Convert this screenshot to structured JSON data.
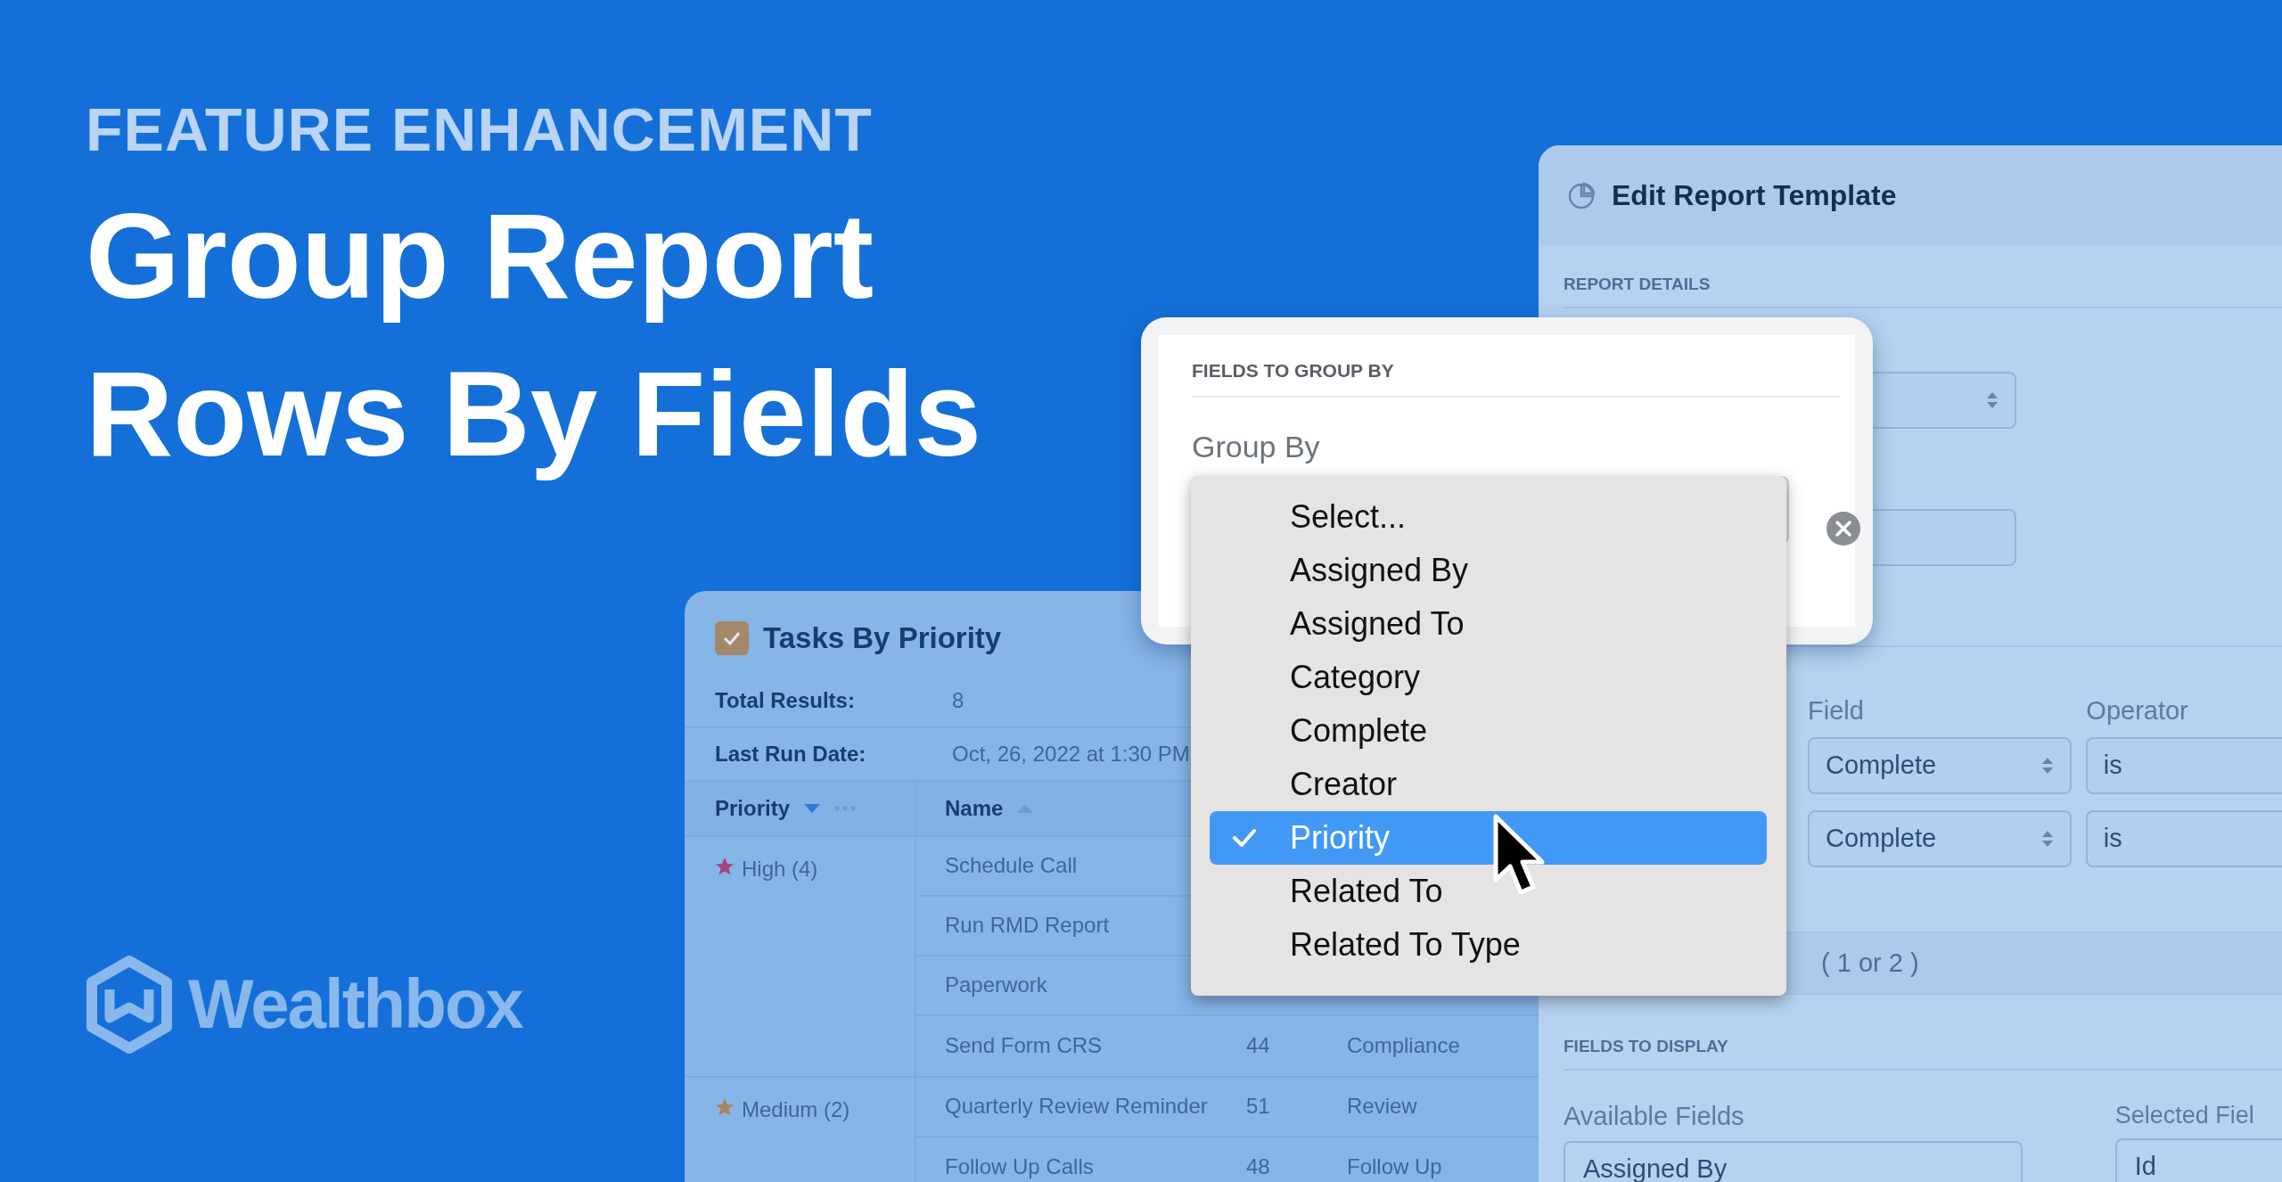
{
  "banner": {
    "eyebrow": "FEATURE ENHANCEMENT",
    "headline_lines": [
      "Group Report",
      "Rows By Fields"
    ],
    "brand": "Wealthbox"
  },
  "tasks_report": {
    "title": "Tasks By Priority",
    "summary": [
      {
        "label": "Total Results:",
        "value": "8"
      },
      {
        "label": "Last Run Date:",
        "value": "Oct, 26, 2022 at 1:30 PM"
      }
    ],
    "columns": [
      {
        "label": "Priority",
        "descending": true
      },
      {
        "label": "Name",
        "descending": false
      }
    ],
    "groups": [
      {
        "label": "High (4)",
        "color": "#a0467c",
        "rows": [
          {
            "name": "Schedule Call"
          },
          {
            "name": "Run RMD Report"
          },
          {
            "name": "Paperwork"
          },
          {
            "name": "Send Form CRS",
            "column_3": "44",
            "column_4": "Compliance"
          }
        ]
      },
      {
        "label": "Medium (2)",
        "color": "#a8835f",
        "rows": [
          {
            "name": "Quarterly Review Reminder",
            "column_3": "51",
            "column_4": "Review"
          },
          {
            "name": "Follow Up Calls",
            "column_3": "48",
            "column_4": "Follow Up"
          }
        ]
      }
    ]
  },
  "edit_template": {
    "title": "Edit Report Template",
    "report_details_heading": "REPORT DETAILS",
    "filters": {
      "headers": [
        "Field",
        "Operator"
      ],
      "rows": [
        {
          "field": "Complete",
          "operator": "is"
        },
        {
          "field": "Complete",
          "operator": "is"
        }
      ],
      "note": "( 1 or 2 )"
    },
    "fields_to_display": {
      "heading": "FIELDS TO DISPLAY",
      "available": {
        "label": "Available Fields",
        "items": [
          "Assigned By"
        ]
      },
      "selected": {
        "label": "Selected Fiel",
        "items": [
          "Id"
        ]
      }
    }
  },
  "group_by_dialog": {
    "heading": "FIELDS TO GROUP BY",
    "label": "Group By",
    "options": [
      {
        "label": "Select...",
        "selected": false
      },
      {
        "label": "Assigned By",
        "selected": false
      },
      {
        "label": "Assigned To",
        "selected": false
      },
      {
        "label": "Category",
        "selected": false
      },
      {
        "label": "Complete",
        "selected": false
      },
      {
        "label": "Creator",
        "selected": false
      },
      {
        "label": "Priority",
        "selected": true
      },
      {
        "label": "Related To",
        "selected": false
      },
      {
        "label": "Related To Type",
        "selected": false
      }
    ]
  }
}
